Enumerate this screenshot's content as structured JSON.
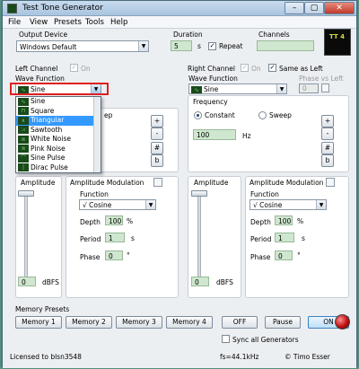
{
  "window": {
    "title": "Test Tone Generator",
    "min": "–",
    "max": "▢",
    "close": "✕"
  },
  "menu": [
    "File",
    "View",
    "Presets",
    "Tools",
    "Help"
  ],
  "output": {
    "label": "Output Device",
    "value": "Windows Default"
  },
  "duration": {
    "label": "Duration",
    "value": "5",
    "unit": "s",
    "repeat_label": "Repeat",
    "repeat": true
  },
  "channels": {
    "label": "Channels",
    "value": ""
  },
  "logo": {
    "text": "TT\n4"
  },
  "left": {
    "title": "Left Channel",
    "on_label": "On",
    "wave_label": "Wave Function",
    "wave": "Sine",
    "freq_value": "",
    "amp_label": "Amplitude",
    "amp_value": "0",
    "amp_unit": "dBFS",
    "mod_label": "Amplitude Modulation",
    "func_label": "Function",
    "func": "Cosine",
    "depth_label": "Depth",
    "depth": "100",
    "depth_unit": "%",
    "period_label": "Period",
    "period": "1",
    "period_unit": "s",
    "phase_label": "Phase",
    "phase": "0",
    "phase_unit": "°",
    "sweep_partial": "ep",
    "btns": [
      "+",
      "-",
      "#",
      "b"
    ]
  },
  "dropdown": [
    "Sine",
    "Square",
    "Triangular",
    "Sawtooth",
    "White Noise",
    "Pink Noise",
    "Sine Pulse",
    "Dirac Pulse"
  ],
  "dropdown_selected": "Triangular",
  "right": {
    "title": "Right Channel",
    "on_label": "On",
    "same_label": "Same as Left",
    "wave_label": "Wave Function",
    "wave": "Sine",
    "phase_vs_left": "Phase vs Left",
    "phase_value": "0",
    "freq_label": "Frequency",
    "constant": "Constant",
    "sweep": "Sweep",
    "freq": "100",
    "freq_unit": "Hz",
    "amp_label": "Amplitude",
    "amp_value": "0",
    "amp_unit": "dBFS",
    "mod_label": "Amplitude Modulation",
    "func_label": "Function",
    "func": "Cosine",
    "depth_label": "Depth",
    "depth": "100",
    "depth_unit": "%",
    "period_label": "Period",
    "period": "1",
    "period_unit": "s",
    "phase_label": "Phase",
    "phase": "0",
    "phase_unit": "°",
    "btns": [
      "+",
      "-",
      "#",
      "b"
    ]
  },
  "memory": {
    "label": "Memory Presets",
    "buttons": [
      "Memory 1",
      "Memory 2",
      "Memory 3",
      "Memory 4"
    ]
  },
  "controls": {
    "off": "OFF",
    "pause": "Pause",
    "on": "ON",
    "sync": "Sync all Generators"
  },
  "status": {
    "license": "Licensed to blsn3548",
    "fs": "fs=44.1kHz",
    "copyright": "© Timo Esser"
  }
}
